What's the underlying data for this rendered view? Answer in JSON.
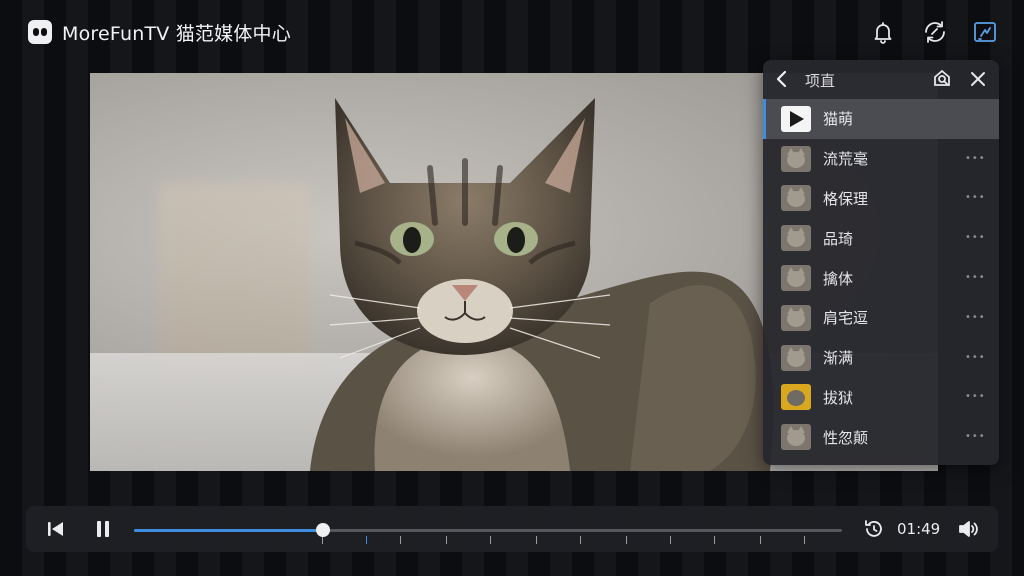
{
  "app": {
    "title": "MoreFunTV 猫范媒体中心",
    "icons": [
      "logo-icon",
      "bell-icon",
      "sync-icon",
      "cast-icon"
    ]
  },
  "video": {
    "subject": "tabby cat"
  },
  "panel": {
    "title": "项直",
    "items": [
      {
        "label": "猫萌",
        "thumb": "play",
        "active": true
      },
      {
        "label": "流荒毫",
        "thumb": "cat"
      },
      {
        "label": "格保理",
        "thumb": "cat"
      },
      {
        "label": "品琦",
        "thumb": "cat"
      },
      {
        "label": "擒体",
        "thumb": "cat"
      },
      {
        "label": "肩宅逗",
        "thumb": "cat"
      },
      {
        "label": "渐满",
        "thumb": "cat"
      },
      {
        "label": "拔狱",
        "thumb": "yellow"
      },
      {
        "label": "性忽颠",
        "thumb": "cat"
      }
    ]
  },
  "player": {
    "time": "01:49",
    "progress": 0.267,
    "accent": "#3f8de0"
  }
}
